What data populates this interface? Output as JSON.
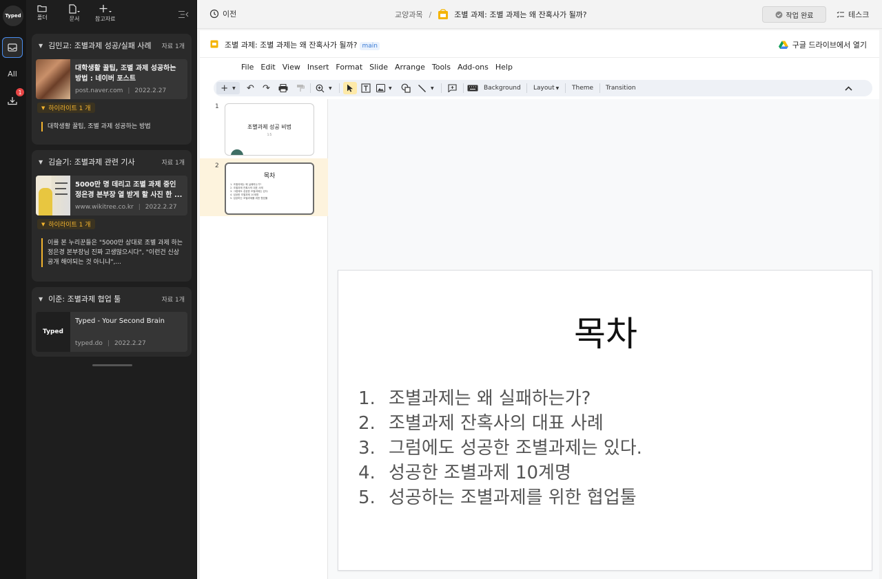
{
  "rail": {
    "logo_text": "Typed",
    "all_label": "All",
    "inbox_badge": "1"
  },
  "sidebar": {
    "tools": [
      {
        "label": "폴더",
        "icon": "folder-icon"
      },
      {
        "label": "문서",
        "icon": "document-icon"
      },
      {
        "label": "참고자료",
        "icon": "plus-icon"
      }
    ],
    "groups": [
      {
        "title": "김민교: 조별과제 성공/실패 사례",
        "count": "자료 1개",
        "card": {
          "title": "대학생활 꿀팁, 조별 과제 성공하는 방법 : 네이버 포스트",
          "source": "post.naver.com",
          "date": "2022.2.27"
        },
        "highlight_tag": "하이라이트 1 개",
        "quote": "대학생활 꿀팁, 조별 과제 성공하는 방법"
      },
      {
        "title": "김슬기: 조별과제 관련 기사",
        "count": "자료 1개",
        "card": {
          "title": "5000만 명 데리고 조별 과제 중인 정은경 본부장 열 받게 할 사진 한 ...",
          "source": "www.wikitree.co.kr",
          "date": "2022.2.27"
        },
        "highlight_tag": "하이라이트 1 개",
        "quote": "이를 본 누리꾼들은 \"5000만 상대로 조별 과제 하는 정은경 본부장님 진짜 고생많으시다\", \"이런건 신상 공개 해야되는 것 아니냐\",..."
      },
      {
        "title": "이준: 조별과제 협업 툴",
        "count": "자료 1개",
        "card": {
          "title": "Typed - Your Second Brain",
          "source": "typed.do",
          "date": "2022.2.27",
          "thumb_text": "Typed"
        }
      }
    ]
  },
  "topbar": {
    "back_label": "이전",
    "crumb_parent": "교양과목",
    "crumb_sep": "/",
    "doc_title": "조별 과제: 조별 과제는 왜 잔혹사가 될까?",
    "done_label": "작업 완료",
    "task_label": "테스크"
  },
  "doc": {
    "title": "조별 과제: 조별 과제는 왜 잔혹사가 될까?",
    "branch": "main",
    "drive_label": "구글 드라이브에서 열기"
  },
  "slides_app": {
    "menu": [
      "File",
      "Edit",
      "View",
      "Insert",
      "Format",
      "Slide",
      "Arrange",
      "Tools",
      "Add-ons",
      "Help"
    ],
    "toolbar": {
      "background": "Background",
      "layout": "Layout",
      "theme": "Theme",
      "transition": "Transition"
    },
    "thumbnails": [
      {
        "num": "1",
        "title": "조별과제 성공 비법",
        "sub": "1:5"
      },
      {
        "num": "2",
        "title": "목차",
        "items": [
          "1.  조별과제는 왜 실패하는가?",
          "2.  조별과제 잔혹사의 대표 사례",
          "3.  그럼에도 성공한 조별과제는 있다.",
          "4.  성공한 조별과제 10계명",
          "5.  성공하는 조별과제를 위한 협업툴"
        ]
      }
    ],
    "current_slide": {
      "title": "목차",
      "items": [
        {
          "n": "1.",
          "text": "조별과제는 왜 실패하는가?"
        },
        {
          "n": "2.",
          "text": "조별과제 잔혹사의 대표 사례"
        },
        {
          "n": "3.",
          "text": "그럼에도 성공한 조별과제는 있다."
        },
        {
          "n": "4.",
          "text": "성공한 조별과제 10계명"
        },
        {
          "n": "5.",
          "text": "성공하는 조별과제를 위한 협업툴"
        }
      ]
    }
  },
  "colors": {
    "accent_blue": "#4a8ef0",
    "highlight_yellow": "#f5b52e",
    "badge_red": "#e84545"
  }
}
